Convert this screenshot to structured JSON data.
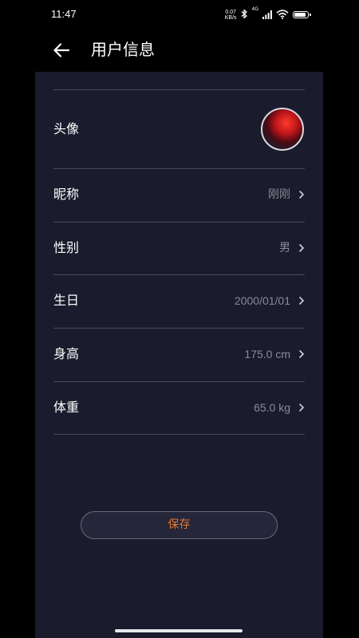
{
  "status_bar": {
    "time": "11:47",
    "net_speed_value": "0.07",
    "net_speed_unit": "KB/s",
    "network_type": "4G",
    "battery_level": 0.85
  },
  "header": {
    "title": "用户信息",
    "back_icon": "arrow-left-icon"
  },
  "rows": [
    {
      "label": "头像",
      "type": "avatar"
    },
    {
      "label": "昵称",
      "value": "刚刚"
    },
    {
      "label": "性别",
      "value": "男"
    },
    {
      "label": "生日",
      "value": "2000/01/01"
    },
    {
      "label": "身高",
      "value": "175.0 cm"
    },
    {
      "label": "体重",
      "value": "65.0 kg"
    }
  ],
  "save_label": "保存",
  "colors": {
    "background": "#1a1b2c",
    "accent": "#e7772e",
    "divider": "#4a4b5a",
    "value_text": "#8a8b97"
  }
}
